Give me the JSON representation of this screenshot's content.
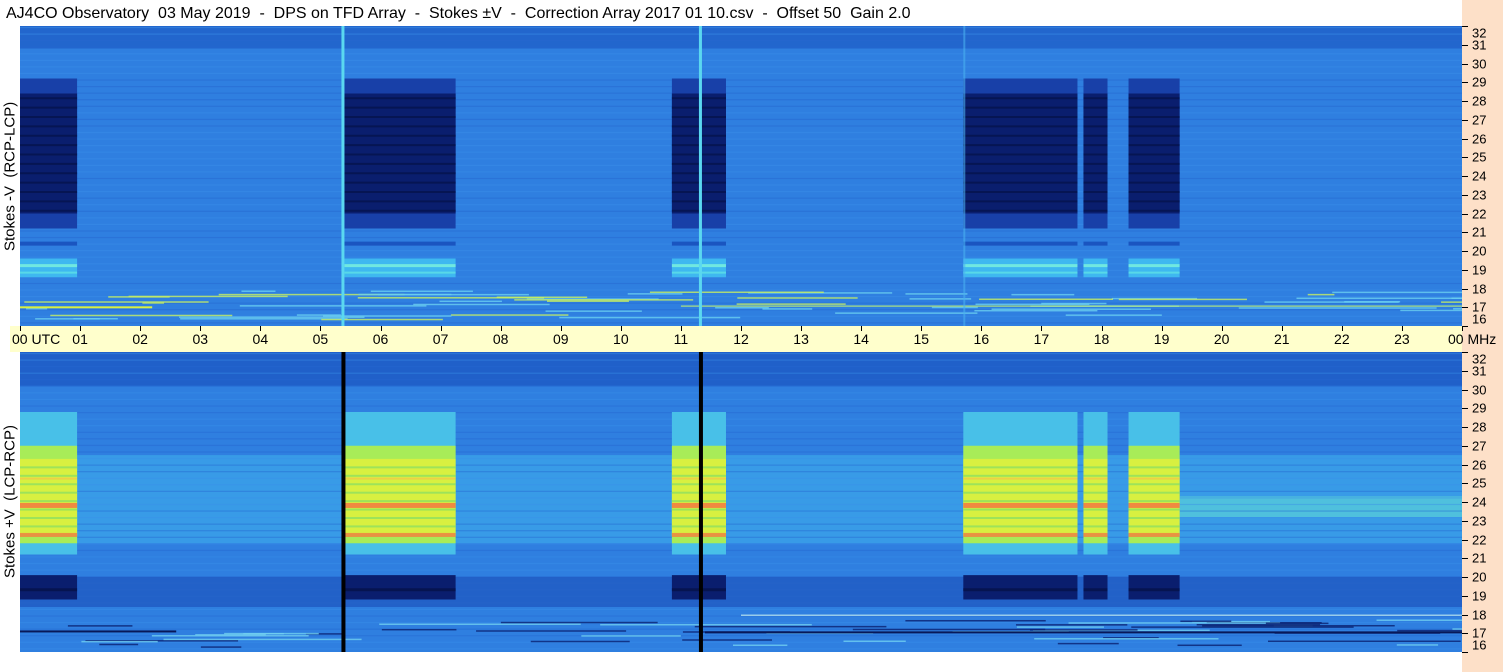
{
  "title": "AJ4CO Observatory  03 May 2019  -  DPS on TFD Array  -  Stokes ±V  -  Correction Array 2017 01 10.csv  -  Offset 50  Gain 2.0",
  "panels": {
    "top_label": "Stokes -V  (RCP-LCP)",
    "bottom_label": "Stokes +V  (LCP-RCP)"
  },
  "time_axis": {
    "labels": [
      "00 UTC",
      "01",
      "02",
      "03",
      "04",
      "05",
      "06",
      "07",
      "08",
      "09",
      "10",
      "11",
      "12",
      "13",
      "14",
      "15",
      "16",
      "17",
      "18",
      "19",
      "20",
      "21",
      "22",
      "23",
      "00 MHz"
    ]
  },
  "freq_axis": {
    "labels": [
      "32",
      "31",
      "30",
      "29",
      "28",
      "27",
      "26",
      "25",
      "24",
      "23",
      "22",
      "21",
      "20",
      "19",
      "18",
      "17",
      "16"
    ]
  },
  "colors": {
    "background": "#2f7fe0",
    "band_dark": "#0a1e6e",
    "band_hot": "#f08a40",
    "band_yellow": "#d8f040",
    "axis_bar": "#ffffcc",
    "right_strip": "#fde0c8"
  },
  "chart_data": {
    "type": "heatmap",
    "title": "AJ4CO Observatory  03 May 2019  -  DPS on TFD Array  -  Stokes ±V  -  Correction Array 2017 01 10.csv  -  Offset 50  Gain 2.0",
    "x": [
      "00 UTC",
      "01",
      "02",
      "03",
      "04",
      "05",
      "06",
      "07",
      "08",
      "09",
      "10",
      "11",
      "12",
      "13",
      "14",
      "15",
      "16",
      "17",
      "18",
      "19",
      "20",
      "21",
      "22",
      "23",
      "00 MHz"
    ],
    "y": [
      "32",
      "31",
      "30",
      "29",
      "28",
      "27",
      "26",
      "25",
      "24",
      "23",
      "22",
      "21",
      "20",
      "19",
      "18",
      "17",
      "16"
    ],
    "xlim": [
      0,
      24
    ],
    "ylim": [
      16,
      32
    ],
    "series": [
      {
        "name": "Stokes -V  (RCP-LCP)"
      },
      {
        "name": "Stokes +V  (LCP-RCP)"
      }
    ]
  }
}
